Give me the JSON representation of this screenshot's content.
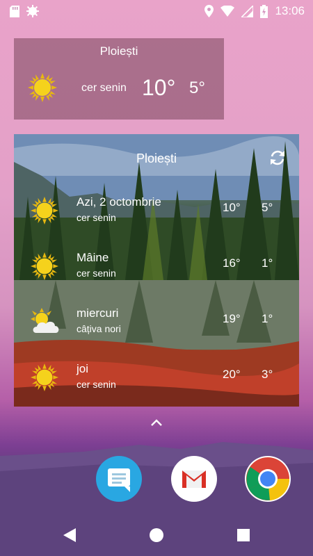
{
  "status_bar": {
    "time": "13:06",
    "icons": [
      "sd-card-icon",
      "settings-icon",
      "location-icon",
      "wifi-icon",
      "signal-icon",
      "battery-charging-icon"
    ]
  },
  "small_widget": {
    "city": "Ploiești",
    "condition": "cer senin",
    "temp_high": "10°",
    "temp_low": "5°",
    "icon": "sun-icon"
  },
  "forecast_widget": {
    "city": "Ploiești",
    "refresh_icon": "refresh-icon",
    "days": [
      {
        "day": "Azi, 2 octombrie",
        "condition": "cer senin",
        "high": "10°",
        "low": "5°",
        "icon": "sun-icon"
      },
      {
        "day": "Mâine",
        "condition": "cer senin",
        "high": "16°",
        "low": "1°",
        "icon": "sun-icon"
      },
      {
        "day": "miercuri",
        "condition": "câțiva nori",
        "high": "19°",
        "low": "1°",
        "icon": "partly-cloudy-icon"
      },
      {
        "day": "joi",
        "condition": "cer senin",
        "high": "20°",
        "low": "3°",
        "icon": "sun-icon"
      }
    ]
  },
  "dock": {
    "apps": [
      "messages-app-icon",
      "gmail-app-icon",
      "chrome-app-icon"
    ]
  },
  "navigation": {
    "buttons": [
      "back-button",
      "home-button",
      "recents-button"
    ]
  },
  "colors": {
    "wallpaper_top": "#e9a3c9",
    "wallpaper_bottom": "#4e3870",
    "widget_bg": "#78465a",
    "sun": "#f2c81a"
  }
}
